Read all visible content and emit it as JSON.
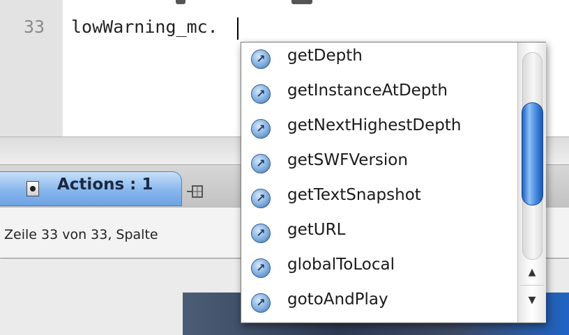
{
  "editor": {
    "line_number": "33",
    "code_text": "lowWarning_mc."
  },
  "panel": {
    "tab_label": "Actions : 1",
    "tab_icon": "document-icon",
    "pin_icon": "pin-icon",
    "status_text": "Zeile 33 von 33, Spalte"
  },
  "autocomplete": {
    "item_icon": "method-arrow-icon",
    "items": [
      "getDepth",
      "getInstanceAtDepth",
      "getNextHighestDepth",
      "getSWFVersion",
      "getTextSnapshot",
      "getURL",
      "globalToLocal",
      "gotoAndPlay"
    ],
    "scroll_up_arrow": "▲",
    "scroll_down_arrow": "▼"
  },
  "colors": {
    "tab_accent": "#87b6ec",
    "scroll_thumb": "#4a8fe3",
    "item_icon": "#7aa8d9"
  }
}
